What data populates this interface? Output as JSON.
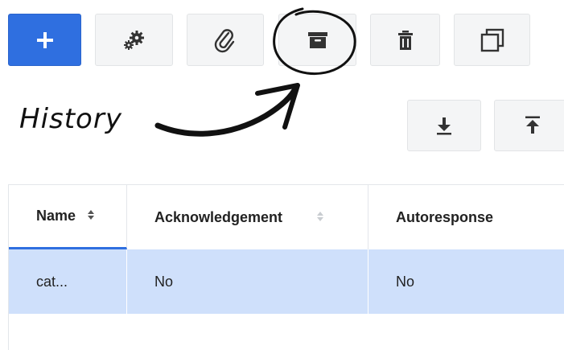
{
  "toolbar": {
    "buttons": [
      {
        "id": "add",
        "icon": "plus-icon"
      },
      {
        "id": "settings",
        "icon": "gears-icon"
      },
      {
        "id": "attachment",
        "icon": "paperclip-icon"
      },
      {
        "id": "history",
        "icon": "archive-box-icon"
      },
      {
        "id": "delete",
        "icon": "trash-icon"
      },
      {
        "id": "copy",
        "icon": "copy-icon"
      },
      {
        "id": "download",
        "icon": "download-icon"
      },
      {
        "id": "upload",
        "icon": "upload-icon"
      }
    ]
  },
  "annotation": {
    "text": "History"
  },
  "table": {
    "columns": [
      {
        "label": "Name",
        "sort": "sortable"
      },
      {
        "label": "Acknowledgement",
        "sort": "sortable"
      },
      {
        "label": "Autoresponse",
        "sort": "none"
      }
    ],
    "rows": [
      {
        "name": "cat...",
        "acknowledgement": "No",
        "autoresponse": "No",
        "selected": true
      }
    ]
  },
  "colors": {
    "accent": "#2f6fe0",
    "selected_row": "#cfe0fb",
    "button_bg": "#f4f5f6"
  }
}
